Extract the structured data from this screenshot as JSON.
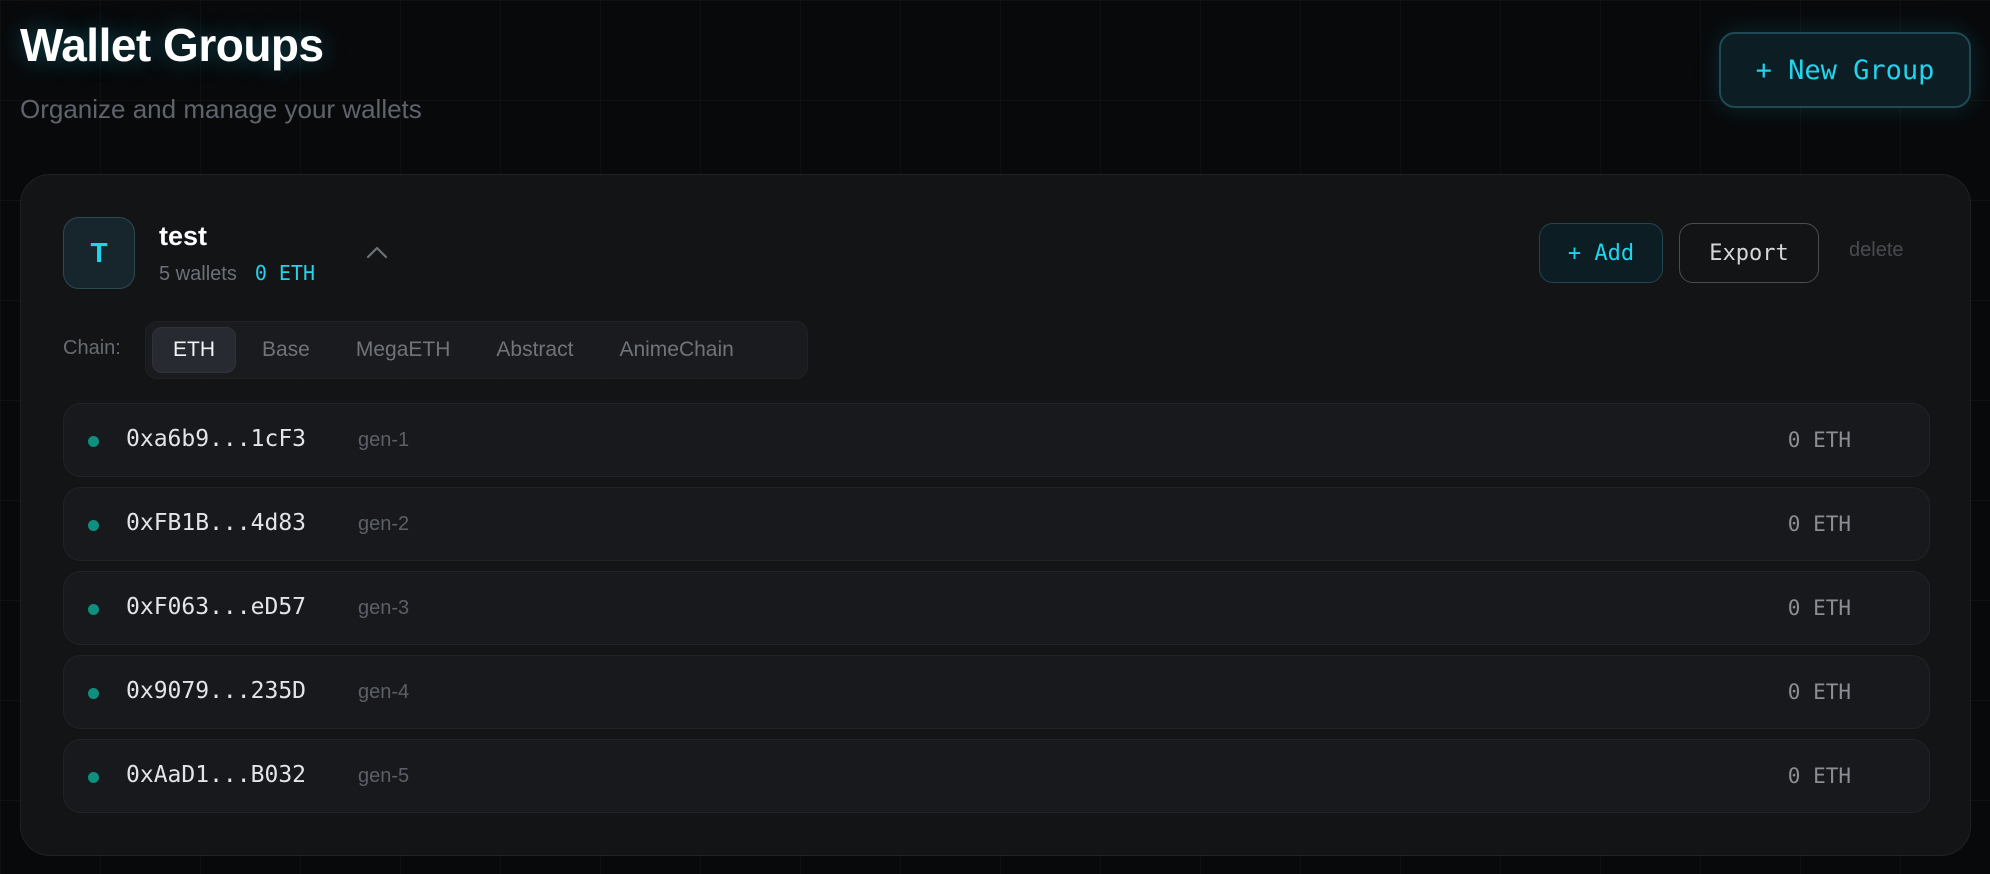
{
  "header": {
    "title": "Wallet Groups",
    "subtitle": "Organize and manage your wallets",
    "new_group_label": "+ New Group"
  },
  "group": {
    "avatar_letter": "T",
    "name": "test",
    "wallet_count": "5 wallets",
    "balance": "0 ETH",
    "add_label": "+ Add",
    "export_label": "Export",
    "delete_label": "delete",
    "chain_label": "Chain:",
    "chains": [
      "ETH",
      "Base",
      "MegaETH",
      "Abstract",
      "AnimeChain"
    ],
    "active_chain": "ETH",
    "wallets": [
      {
        "address": "0xa6b9...1cF3",
        "label": "gen-1",
        "balance": "0 ETH"
      },
      {
        "address": "0xFB1B...4d83",
        "label": "gen-2",
        "balance": "0 ETH"
      },
      {
        "address": "0xF063...eD57",
        "label": "gen-3",
        "balance": "0 ETH"
      },
      {
        "address": "0x9079...235D",
        "label": "gen-4",
        "balance": "0 ETH"
      },
      {
        "address": "0xAaD1...B032",
        "label": "gen-5",
        "balance": "0 ETH"
      }
    ]
  },
  "colors": {
    "accent": "#22d3ee",
    "status_dot": "#0f8f7d",
    "background": "#08090b",
    "card": "#141518"
  },
  "icons": {
    "collapse": "chevron-up-icon",
    "status": "status-dot-icon"
  }
}
